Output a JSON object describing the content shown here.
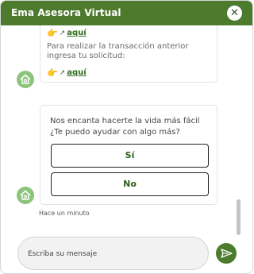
{
  "header": {
    "title": "Ema Asesora Virtual",
    "close_glyph": "✕"
  },
  "messages": [
    {
      "link_1": {
        "icon": "pointing-hand-icon",
        "ext_icon": "external-link-icon",
        "label": "aquí"
      },
      "text": "Para realizar la transacción anterior ingresa tu solicitud:",
      "link_2": {
        "icon": "pointing-hand-icon",
        "ext_icon": "external-link-icon",
        "label": "aquí"
      }
    },
    {
      "question": "Nos encanta hacerte la vida más fácil ¿Te puedo ayudar con algo más?",
      "options": [
        "Sí",
        "No"
      ],
      "timestamp": "Hace un minuto"
    }
  ],
  "composer": {
    "placeholder": "Escriba su mensaje"
  },
  "colors": {
    "brand": "#4d7b2d",
    "avatar": "#8cc47c",
    "link": "#2f6a1a"
  }
}
